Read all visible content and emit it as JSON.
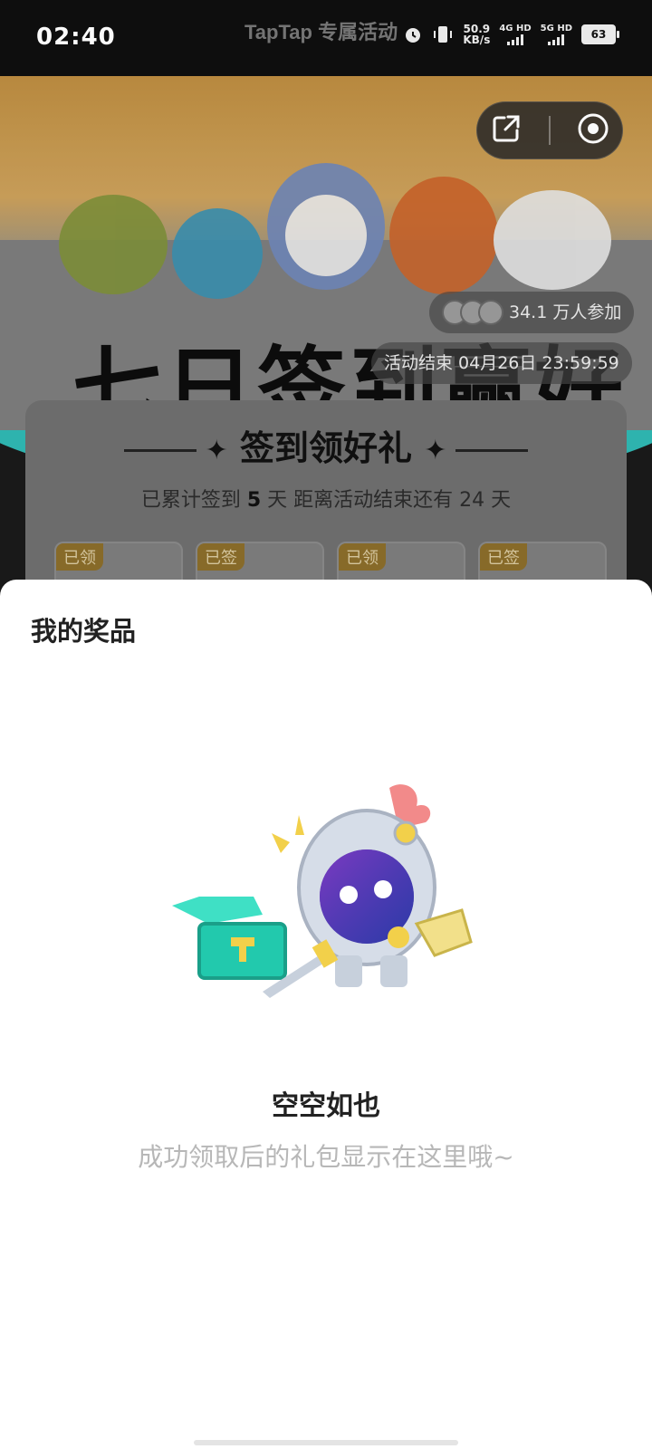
{
  "status_bar": {
    "time": "02:40",
    "center_label": "TapTap 专属活动",
    "network_speed_value": "50.9",
    "network_speed_unit": "KB/s",
    "sim1": "4G HD",
    "sim2": "5G HD",
    "battery": "63"
  },
  "hero": {
    "title": "七日签到赢好礼",
    "participants": "34.1 万人参加",
    "end_time": "活动结束 04月26日 23:59:59"
  },
  "checkin_card": {
    "title": "签到领好礼",
    "subtitle_prefix": "已累计签到 ",
    "days_signed": "5",
    "subtitle_mid": " 天  距离活动结束还有 24 天",
    "tiles": [
      {
        "tag": "已领"
      },
      {
        "tag": "已签"
      },
      {
        "tag": "已领"
      },
      {
        "tag": "已签"
      }
    ]
  },
  "sheet": {
    "title": "我的奖品",
    "empty_title": "空空如也",
    "empty_desc": "成功领取后的礼包显示在这里哦~"
  }
}
